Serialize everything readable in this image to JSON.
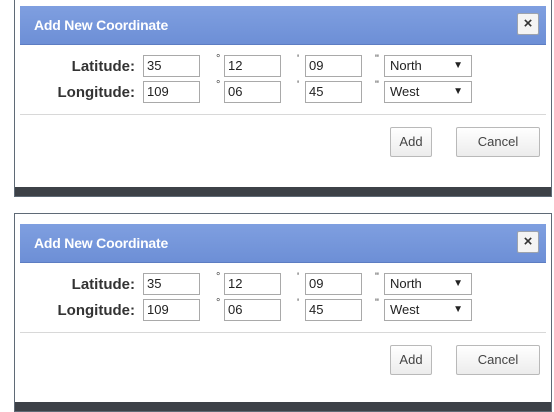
{
  "dialogs": [
    {
      "title": "Add New Coordinate",
      "close_label": "×",
      "latitude": {
        "label": "Latitude:",
        "deg": "35",
        "min": "12",
        "sec": "09",
        "dir": "North"
      },
      "longitude": {
        "label": "Longitude:",
        "deg": "109",
        "min": "06",
        "sec": "45",
        "dir": "West"
      },
      "add_label": "Add",
      "cancel_label": "Cancel"
    },
    {
      "title": "Add New Coordinate",
      "close_label": "×",
      "latitude": {
        "label": "Latitude:",
        "deg": "35",
        "min": "12",
        "sec": "09",
        "dir": "North"
      },
      "longitude": {
        "label": "Longitude:",
        "deg": "109",
        "min": "06",
        "sec": "45",
        "dir": "West"
      },
      "add_label": "Add",
      "cancel_label": "Cancel"
    }
  ],
  "symbols": {
    "degree": "°",
    "minute": "'",
    "second": "\"",
    "dropdown_arrow": "▼"
  },
  "colors": {
    "title_bar": "#7595da",
    "window_base": "#3d4147"
  }
}
